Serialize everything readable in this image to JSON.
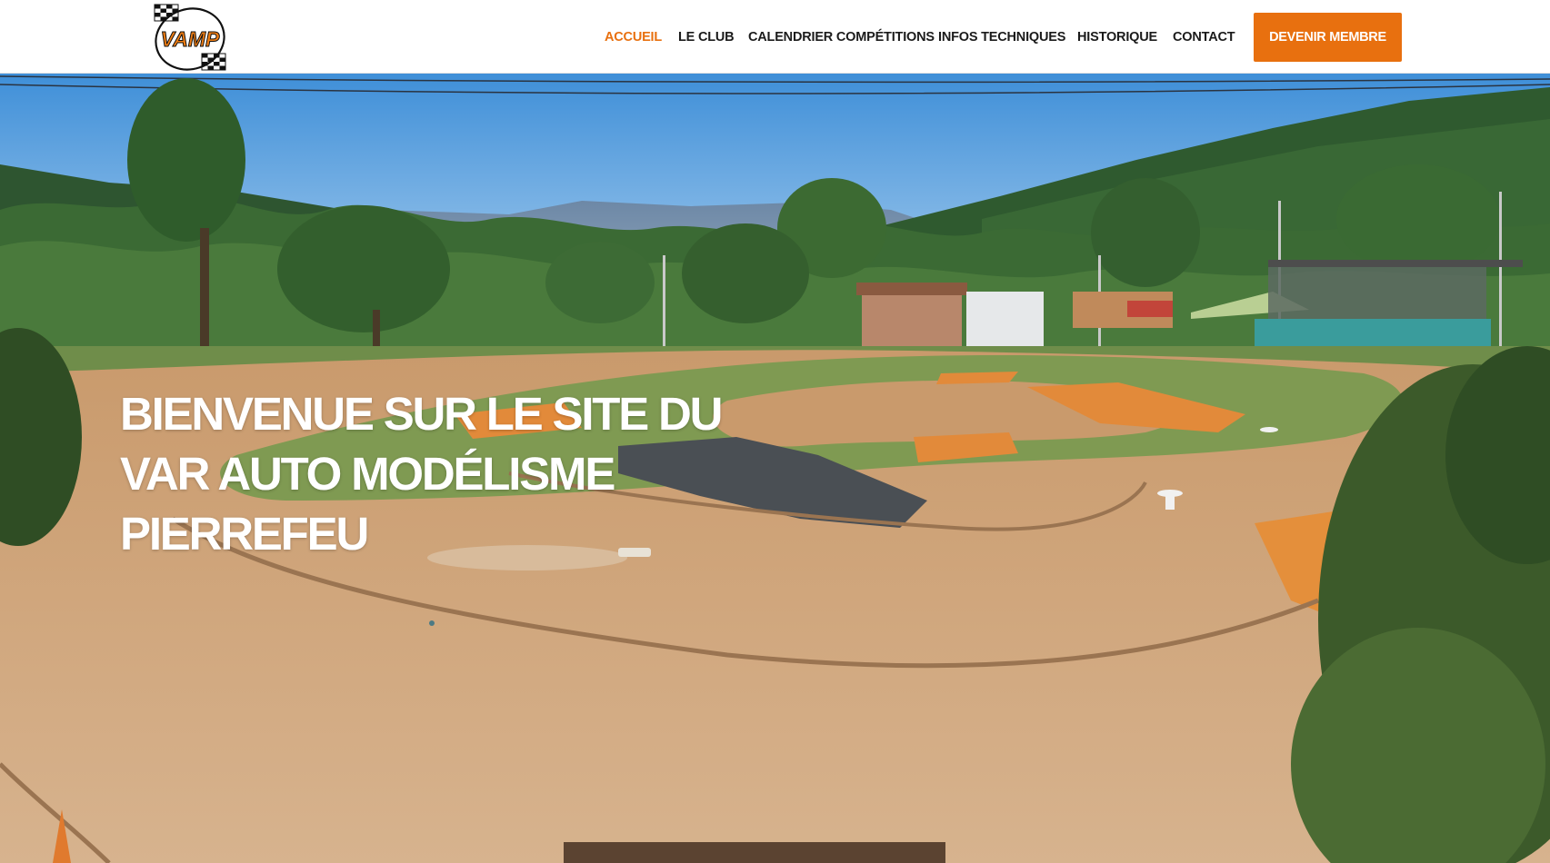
{
  "header": {
    "logo_text": "VAMP",
    "nav": [
      {
        "label": "ACCUEIL",
        "active": true
      },
      {
        "label": "LE CLUB",
        "active": false
      },
      {
        "label": "CALENDRIER COMPÉTITIONS",
        "active": false
      },
      {
        "label": "INFOS TECHNIQUES",
        "active": false
      },
      {
        "label": "HISTORIQUE",
        "active": false
      },
      {
        "label": "CONTACT",
        "active": false
      }
    ],
    "cta_label": "DEVENIR MEMBRE"
  },
  "hero": {
    "title_lines": [
      "BIENVENUE SUR LE SITE DU",
      "VAR AUTO MODÉLISME",
      "PIERREFEU"
    ],
    "image_icon": "rc-track-photo"
  },
  "colors": {
    "accent": "#e8700f",
    "nav_text": "#1b1b1b",
    "hero_text": "#ffffff"
  }
}
